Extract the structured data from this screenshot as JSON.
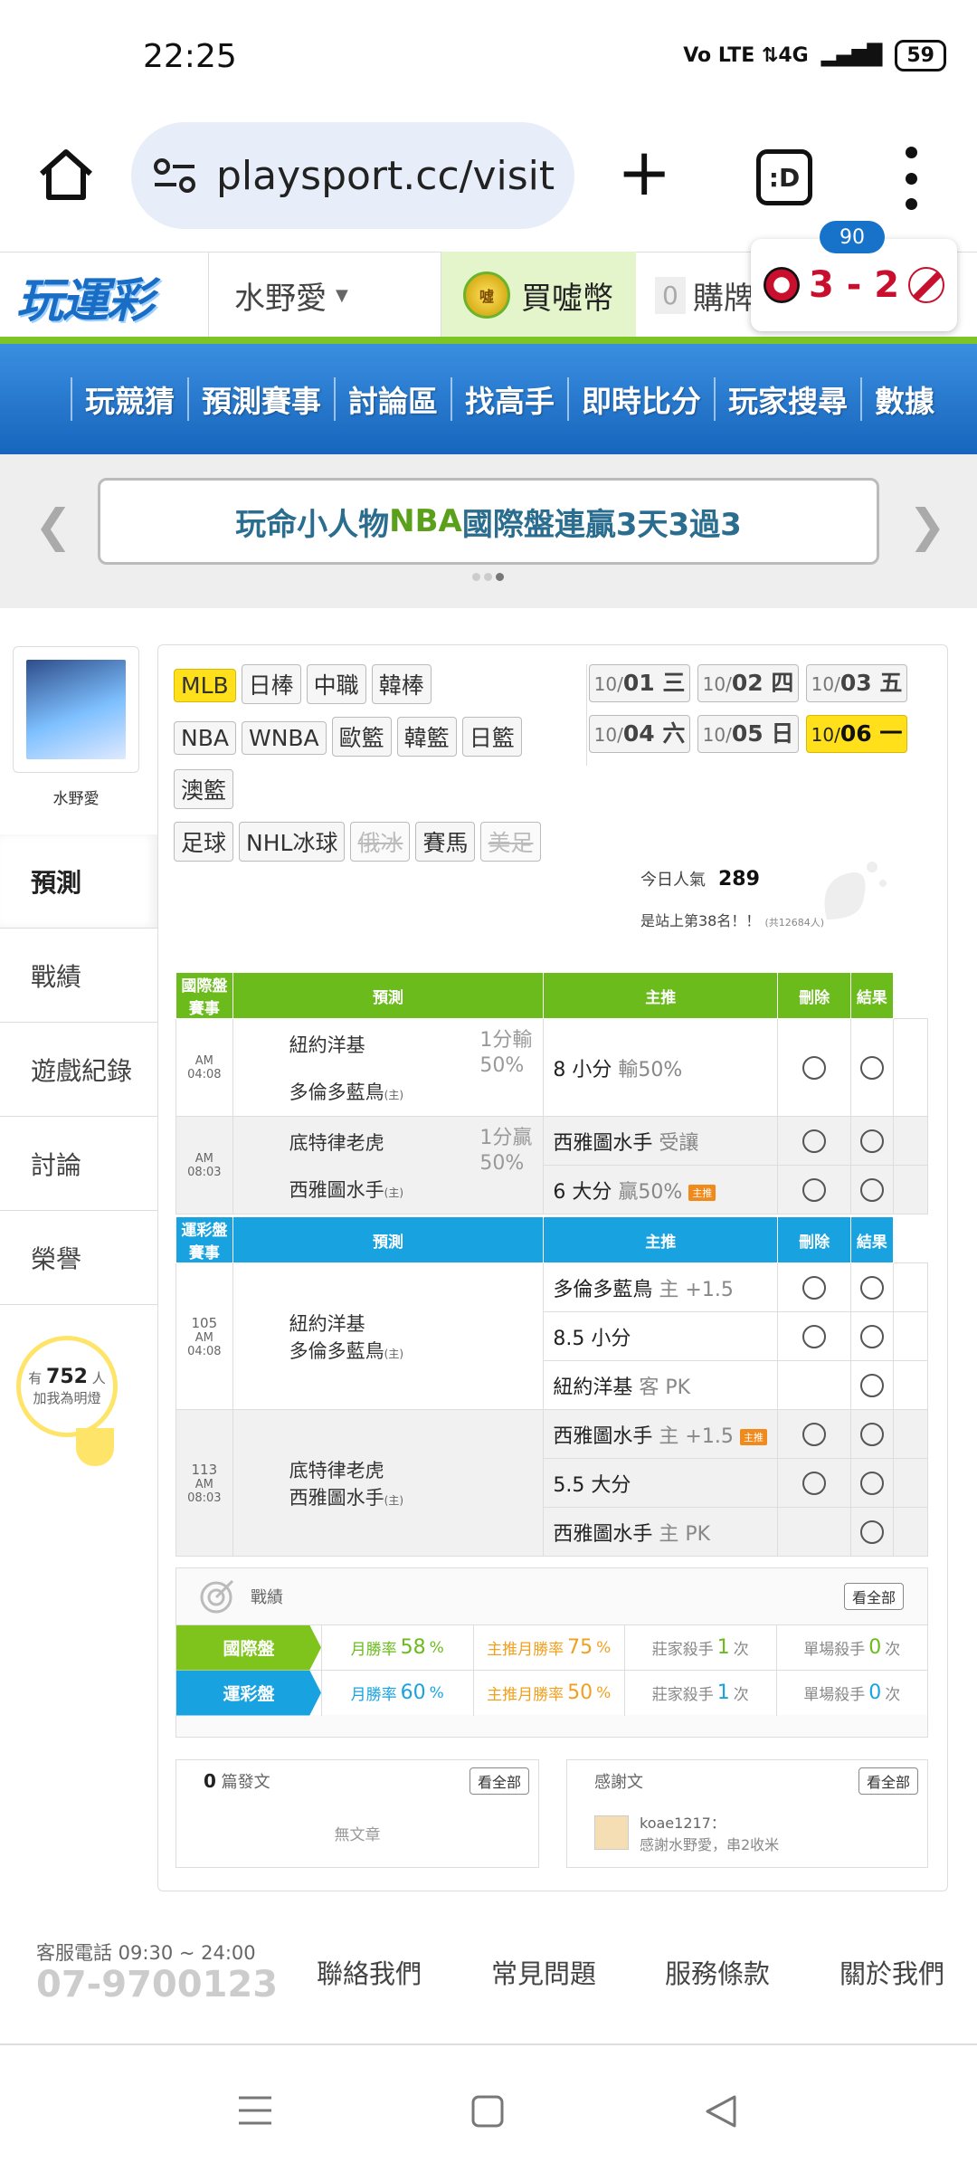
{
  "status": {
    "time": "22:25",
    "network": "Vo LTE  ⇅4G",
    "battery": "59"
  },
  "browser": {
    "url": "playsport.cc/visit",
    "tab_label": ":D"
  },
  "header": {
    "logo": "玩運彩",
    "user": "水野愛",
    "buy_coin": "買噓幣",
    "coin_icon_text": "噓",
    "cart_count": "0",
    "cart_label": "購牌"
  },
  "score": {
    "minute": "90",
    "text": "3 - 2"
  },
  "nav": [
    "玩競猜",
    "預測賽事",
    "討論區",
    "找高手",
    "即時比分",
    "玩家搜尋",
    "數據"
  ],
  "promo": {
    "part1": "玩命小人物 ",
    "highlight": "NBA",
    "part2": " 國際盤連贏3天3過3"
  },
  "profile": {
    "name": "水野愛",
    "menu": [
      "預測",
      "戰績",
      "遊戲紀錄",
      "討論",
      "榮譽"
    ],
    "fans_prefix": "有",
    "fans_count": "752",
    "fans_unit": "人",
    "fans_text": "加我為明燈"
  },
  "sports": [
    {
      "label": "MLB",
      "state": "active"
    },
    {
      "label": "日棒",
      "state": ""
    },
    {
      "label": "中職",
      "state": ""
    },
    {
      "label": "韓棒",
      "state": ""
    },
    {
      "label": "NBA",
      "state": ""
    },
    {
      "label": "WNBA",
      "state": ""
    },
    {
      "label": "歐籃",
      "state": ""
    },
    {
      "label": "韓籃",
      "state": ""
    },
    {
      "label": "日籃",
      "state": ""
    },
    {
      "label": "澳籃",
      "state": ""
    },
    {
      "label": "足球",
      "state": ""
    },
    {
      "label": "NHL冰球",
      "state": ""
    },
    {
      "label": "俄冰",
      "state": "disabled"
    },
    {
      "label": "賽馬",
      "state": ""
    },
    {
      "label": "美足",
      "state": "disabled"
    }
  ],
  "dates": [
    {
      "m": "10/",
      "d": "01 三"
    },
    {
      "m": "10/",
      "d": "02 四"
    },
    {
      "m": "10/",
      "d": "03 五"
    },
    {
      "m": "10/",
      "d": "04 六"
    },
    {
      "m": "10/",
      "d": "05 日"
    },
    {
      "m": "10/",
      "d": "06 一",
      "active": true
    }
  ],
  "stats": {
    "popularity_label": "今日人氣",
    "popularity": "289",
    "rank_text": "是站上第38名！！",
    "rank_small": "(共12684人)"
  },
  "intl_table": {
    "headers": [
      "國際盤賽事",
      "預測",
      "主推",
      "刪除",
      "結果"
    ],
    "games": [
      {
        "time": "AM 04:08",
        "away": "紐約洋基",
        "home": "多倫多藍鳥",
        "home_mark": "(主)",
        "line": "1分輸",
        "line_pct": "50%",
        "preds": [
          {
            "main": "8 小分",
            "sub": "輸50%",
            "tag": ""
          }
        ]
      },
      {
        "time": "AM 08:03",
        "away": "底特律老虎",
        "home": "西雅圖水手",
        "home_mark": "(主)",
        "line": "1分贏",
        "line_pct": "50%",
        "preds": [
          {
            "main": "西雅圖水手",
            "sub": "受讓",
            "tag": ""
          },
          {
            "main": "6 大分",
            "sub": "贏50%",
            "tag": "主推"
          }
        ]
      }
    ]
  },
  "lottery_table": {
    "headers": [
      "運彩盤賽事",
      "預測",
      "主推",
      "刪除",
      "結果"
    ],
    "games": [
      {
        "no": "105",
        "time": "AM 04:08",
        "away": "紐約洋基",
        "home": "多倫多藍鳥",
        "home_mark": "(主)",
        "preds": [
          {
            "main": "多倫多藍鳥",
            "sub": "主 +1.5",
            "tag": "",
            "c": true
          },
          {
            "main": "8.5 小分",
            "sub": "",
            "tag": "",
            "c": true
          },
          {
            "main": "紐約洋基",
            "sub": "客 PK",
            "tag": "",
            "c": false
          }
        ]
      },
      {
        "no": "113",
        "time": "AM 08:03",
        "away": "底特律老虎",
        "home": "西雅圖水手",
        "home_mark": "(主)",
        "preds": [
          {
            "main": "西雅圖水手",
            "sub": "主 +1.5",
            "tag": "主推",
            "c": true
          },
          {
            "main": "5.5 大分",
            "sub": "",
            "tag": "",
            "c": true
          },
          {
            "main": "西雅圖水手",
            "sub": "主 PK",
            "tag": "",
            "c": false
          }
        ]
      }
    ]
  },
  "record": {
    "title": "戰績",
    "see_all": "看全部",
    "rows": [
      {
        "label": "國際盤",
        "color": "#7ec41c",
        "win_label": "月勝率",
        "win": "58",
        "main_label": "主推月勝率",
        "main": "75",
        "killer_label": "莊家殺手",
        "killer": "1",
        "single_label": "單場殺手",
        "single": "0",
        "unit_pct": "%",
        "unit_times": "次"
      },
      {
        "label": "運彩盤",
        "color": "#18a3e0",
        "win_label": "月勝率",
        "win": "60",
        "main_label": "主推月勝率",
        "main": "50",
        "killer_label": "莊家殺手",
        "killer": "1",
        "single_label": "單場殺手",
        "single": "0",
        "unit_pct": "%",
        "unit_times": "次"
      }
    ]
  },
  "posts": {
    "count": "0",
    "label": "篇發文",
    "see_all": "看全部",
    "empty": "無文章"
  },
  "thanks": {
    "title": "感謝文",
    "see_all": "看全部",
    "user": "koae1217：",
    "text": "感謝水野愛，串2收米"
  },
  "footer": {
    "phone_label": "客服電話 09:30 ~ 24:00",
    "phone": "07-9700123",
    "links": [
      "聯絡我們",
      "常見問題",
      "服務條款",
      "關於我們"
    ]
  },
  "colors": {
    "intl_header": "#6cbb1c",
    "lottery_header": "#18a3e0",
    "win_green": "#6cbb1c",
    "win_blue": "#18a3e0",
    "main_orange": "#f0a020"
  }
}
